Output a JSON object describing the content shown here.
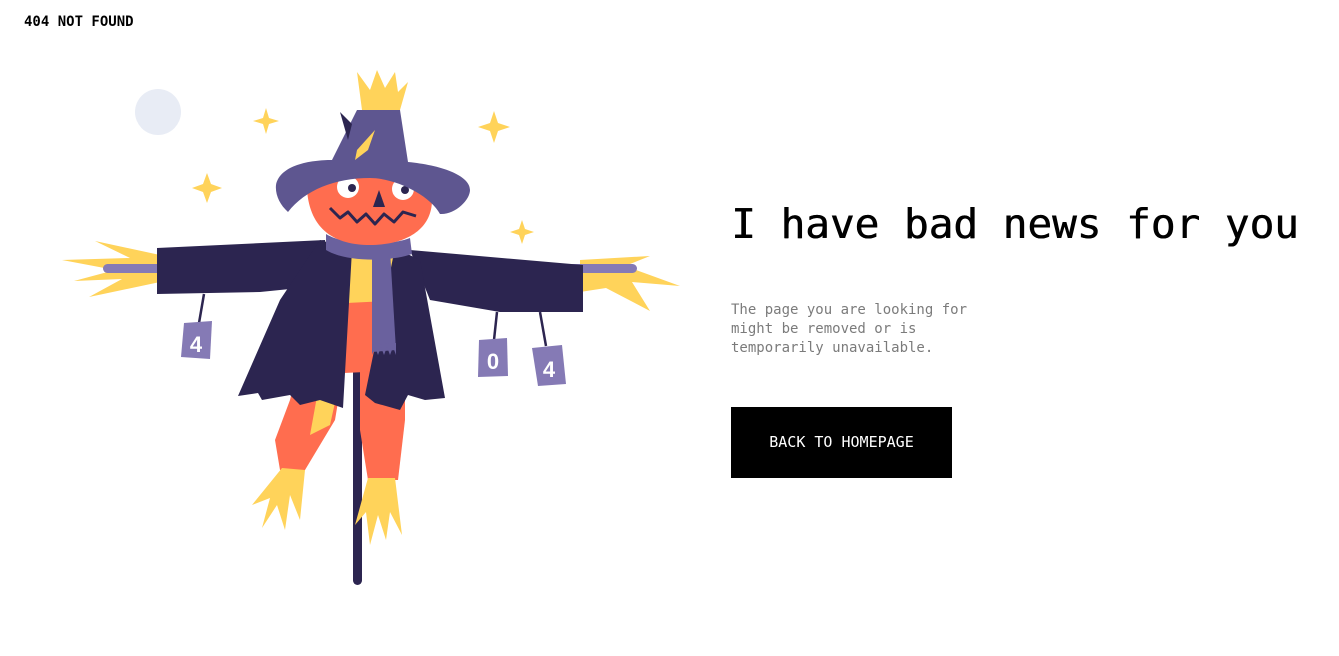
{
  "header": {
    "brand_label": "404 NOT FOUND"
  },
  "main": {
    "headline": "I have bad news for you",
    "message": "The page you are looking for might be removed or is temporarily unavailable.",
    "button_label": "BACK TO HOMEPAGE"
  },
  "illustration": {
    "cans": [
      "4",
      "0",
      "4"
    ],
    "colors": {
      "coat": "#2c2550",
      "hat": "#5e5690",
      "scarf": "#6a619e",
      "pumpkin": "#ff6d4f",
      "straw": "#ffd35a",
      "moon": "#e8ecf5",
      "can": "#857ab5"
    }
  }
}
